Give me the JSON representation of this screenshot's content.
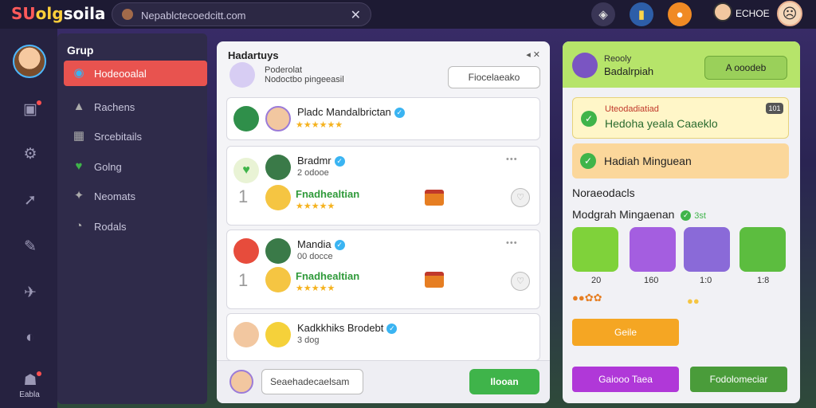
{
  "topbar": {
    "logo": [
      "SU",
      "olg",
      "soila"
    ],
    "search_placeholder": "Nepablctecoedcitt.com",
    "search_icon": "search-icon",
    "close_icon": "close-icon",
    "username": "ECHOE"
  },
  "rail": {
    "items": [
      "home-icon",
      "flag-icon",
      "gear-icon",
      "share-icon",
      "tool-icon",
      "satellite-icon",
      "globe-icon"
    ],
    "bottom_label": "Eabla"
  },
  "group": {
    "title": "Grup",
    "items": [
      {
        "label": "Hodeooalal",
        "icon": "chat-icon",
        "active": true
      },
      {
        "label": "Rachens",
        "icon": "triangle-icon"
      },
      {
        "label": "Srcebitails",
        "icon": "grid-icon"
      },
      {
        "label": "Golng",
        "icon": "heart-icon"
      },
      {
        "label": "Neomats",
        "icon": "tools-icon"
      },
      {
        "label": "Rodals",
        "icon": "gauge-icon"
      }
    ]
  },
  "middle": {
    "title": "Hadartuys",
    "controls": "◂   ✕",
    "sub1": "Poderolat",
    "sub2": "Nodoctbo pingeeasil",
    "button": "Fiocelaeako",
    "cards": [
      {
        "name": "Pladc Mandalbrictan",
        "rating": "★★★★★★"
      },
      {
        "name": "Bradmr",
        "meta": "2 odooe",
        "entry_name": "Fnadhealtian",
        "entry_rating": "★★★★★"
      },
      {
        "name": "Mandia",
        "meta": "00 docce",
        "entry_name": "Fnadhealtian",
        "entry_rating": "★★★★★"
      },
      {
        "name": "Kadkkhiks Brodebt",
        "meta": "3 dog"
      }
    ],
    "footer_input": "Seaehadecaelsam",
    "footer_button": "Ilooan"
  },
  "right": {
    "header_sub": "Reooly",
    "header_title": "Badalrpiah",
    "header_button": "A ooodeb",
    "notice1_sub": "Uteodadiatiad",
    "notice1_title": "Hedoha yeala Caaeklo",
    "notice2_title": "Hadiah Minguean",
    "section1": "Noraeodacls",
    "section2": "Modgrah Mingaenan",
    "section2_extra": "3st",
    "tiles": [
      {
        "label": "20",
        "color": "#7fd23a"
      },
      {
        "label": "160",
        "color": "#a45ee0"
      },
      {
        "label": "1:0",
        "color": "#8a6ad8"
      },
      {
        "label": "1:8",
        "color": "#5cbd3f"
      }
    ],
    "badge_text": "101",
    "gold_button": "Geile",
    "purple_button": "Gaiooo Taea",
    "green_button": "Fodolomeciar"
  },
  "colors": {
    "accent_red": "#e8534f",
    "accent_green": "#3fb44a",
    "accent_gold": "#f5a623",
    "accent_purple": "#b038d8"
  }
}
